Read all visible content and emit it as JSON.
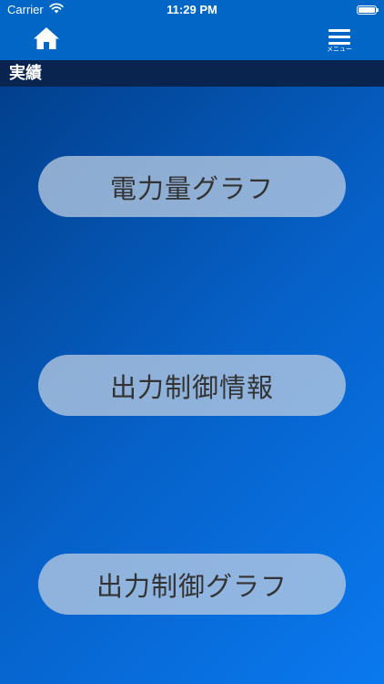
{
  "status_bar": {
    "carrier": "Carrier",
    "time": "11:29 PM",
    "wifi_icon": "wifi-icon",
    "battery_icon": "battery-icon"
  },
  "nav": {
    "home_icon": "home-icon",
    "menu_icon": "hamburger-menu-icon",
    "menu_label": "メニュー"
  },
  "section": {
    "title": "実績"
  },
  "buttons": [
    {
      "label": "電力量グラフ"
    },
    {
      "label": "出力制御情報"
    },
    {
      "label": "出力制御グラフ"
    }
  ],
  "colors": {
    "nav_bar": "#0166c6",
    "section_bar": "#0a2450",
    "background_start": "#013a83",
    "background_end": "#0a79ef",
    "button_text": "#333333"
  }
}
